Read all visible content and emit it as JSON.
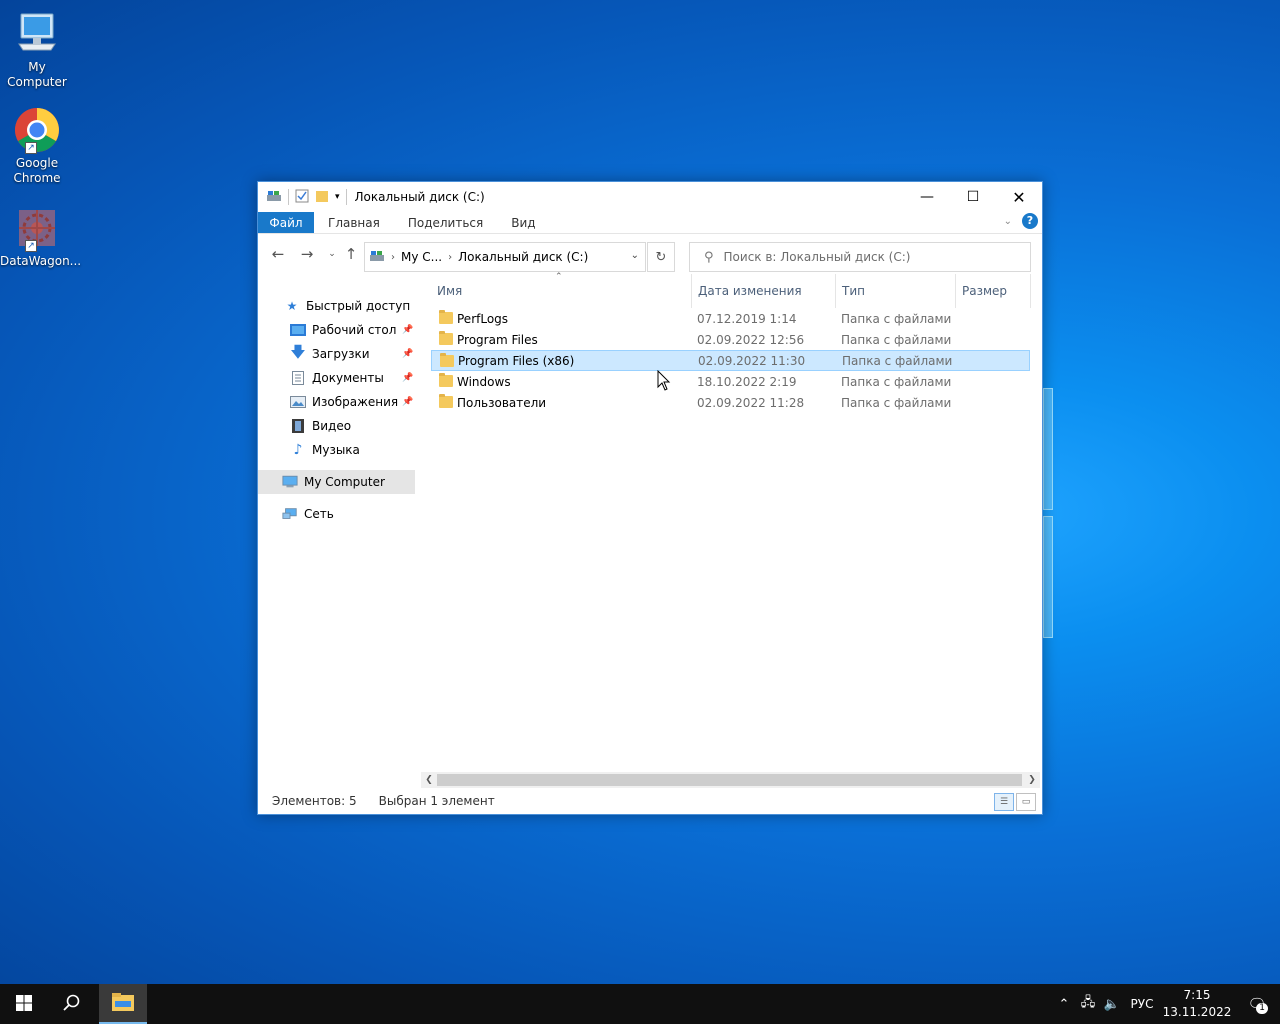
{
  "desktop": {
    "icons": [
      {
        "label": "My Computer"
      },
      {
        "label": "Google Chrome"
      },
      {
        "label": "DataWagon..."
      }
    ]
  },
  "window": {
    "title": "Локальный диск (C:)",
    "ribbon_tabs": [
      "Файл",
      "Главная",
      "Поделиться",
      "Вид"
    ],
    "help_label": "?",
    "address": {
      "crumbs": [
        "My C...",
        "Локальный диск (C:)"
      ]
    },
    "search": {
      "placeholder": "Поиск в: Локальный диск (C:)"
    },
    "nav": {
      "quick_access": "Быстрый доступ",
      "items": [
        {
          "label": "Рабочий стол",
          "pinned": true
        },
        {
          "label": "Загрузки",
          "pinned": true
        },
        {
          "label": "Документы",
          "pinned": true
        },
        {
          "label": "Изображения",
          "pinned": true
        },
        {
          "label": "Видео",
          "pinned": false
        },
        {
          "label": "Музыка",
          "pinned": false
        }
      ],
      "this_pc": "My Computer",
      "network": "Сеть"
    },
    "columns": {
      "name": "Имя",
      "date": "Дата изменения",
      "type": "Тип",
      "size": "Размер"
    },
    "files": [
      {
        "name": "PerfLogs",
        "date": "07.12.2019 1:14",
        "type": "Папка с файлами",
        "selected": false
      },
      {
        "name": "Program Files",
        "date": "02.09.2022 12:56",
        "type": "Папка с файлами",
        "selected": false
      },
      {
        "name": "Program Files (x86)",
        "date": "02.09.2022 11:30",
        "type": "Папка с файлами",
        "selected": true
      },
      {
        "name": "Windows",
        "date": "18.10.2022 2:19",
        "type": "Папка с файлами",
        "selected": false
      },
      {
        "name": "Пользователи",
        "date": "02.09.2022 11:28",
        "type": "Папка с файлами",
        "selected": false
      }
    ],
    "status": {
      "count": "Элементов: 5",
      "selected": "Выбран 1 элемент"
    }
  },
  "taskbar": {
    "language": "РУС",
    "time": "7:15",
    "date": "13.11.2022",
    "notifications": "1"
  },
  "colors": {
    "accent": "#1979ca",
    "selection": "#cce8ff",
    "taskbar": "#101010"
  }
}
